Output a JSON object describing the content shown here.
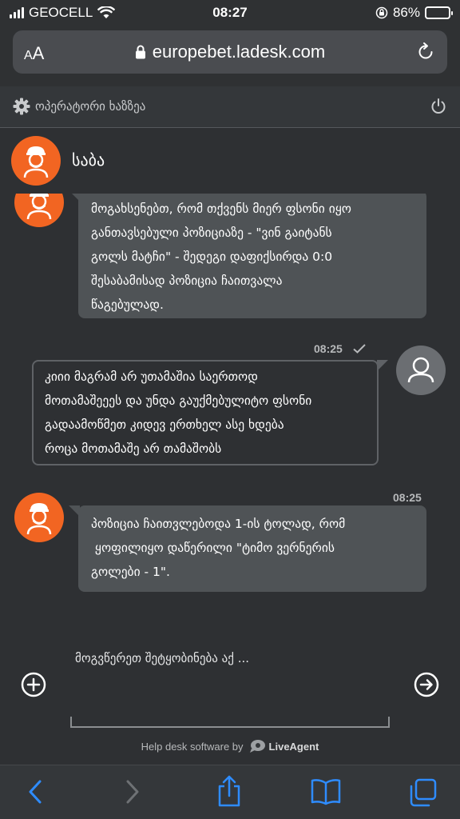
{
  "status_bar": {
    "carrier": "GEOCELL",
    "time": "08:27",
    "battery": "86%",
    "battery_level": 0.86
  },
  "browser": {
    "text_size_label_small": "A",
    "text_size_label_large": "A",
    "url": "europebet.ladesk.com"
  },
  "operator_bar": {
    "label": "ოპერატორი ხაზზეა"
  },
  "agent": {
    "name": "საბა"
  },
  "messages": [
    {
      "from": "agent",
      "text_lines": [
        "მოგახსენებთ, რომ თქვენს მიერ ფსონი იყო",
        "განთავსებული პოზიციაზე - \"ვინ გაიტანს",
        "გოლს მატჩი\" - შედეგი დაფიქსირდა 0:0",
        "შესაბამისად პოზიცია ჩაითვალა",
        "წაგებულად."
      ]
    },
    {
      "from": "user",
      "time": "08:25",
      "text_lines": [
        "კიიი მაგრამ არ უთამაშია საერთოდ",
        "მოთამაშეეეს და უნდა გაუქმებულიტო ფსონი",
        "გადაამოწმეთ კიდევ ერთხელ ასე ხდება",
        "როცა მოთამაშე არ თამაშობს"
      ]
    },
    {
      "from": "agent",
      "time": "08:25",
      "text_lines": [
        "პოზიცია ჩაითვლებოდა 1-ის ტოლად, რომ",
        " ყოფილიყო დაწერილი \"ტიმო ვერნერის",
        "გოლები - 1\"."
      ]
    }
  ],
  "composer": {
    "placeholder": "მოგვწერეთ შეტყობინება აქ ..."
  },
  "footer": {
    "powered_text": "Help desk software by",
    "brand": "LiveAgent"
  },
  "icons": {
    "back": "chevron-left-icon",
    "forward": "chevron-right-icon",
    "share": "share-icon",
    "bookmarks": "book-icon",
    "tabs": "tabs-icon"
  },
  "colors": {
    "accent": "#2e8cff",
    "avatar": "#f26522"
  }
}
